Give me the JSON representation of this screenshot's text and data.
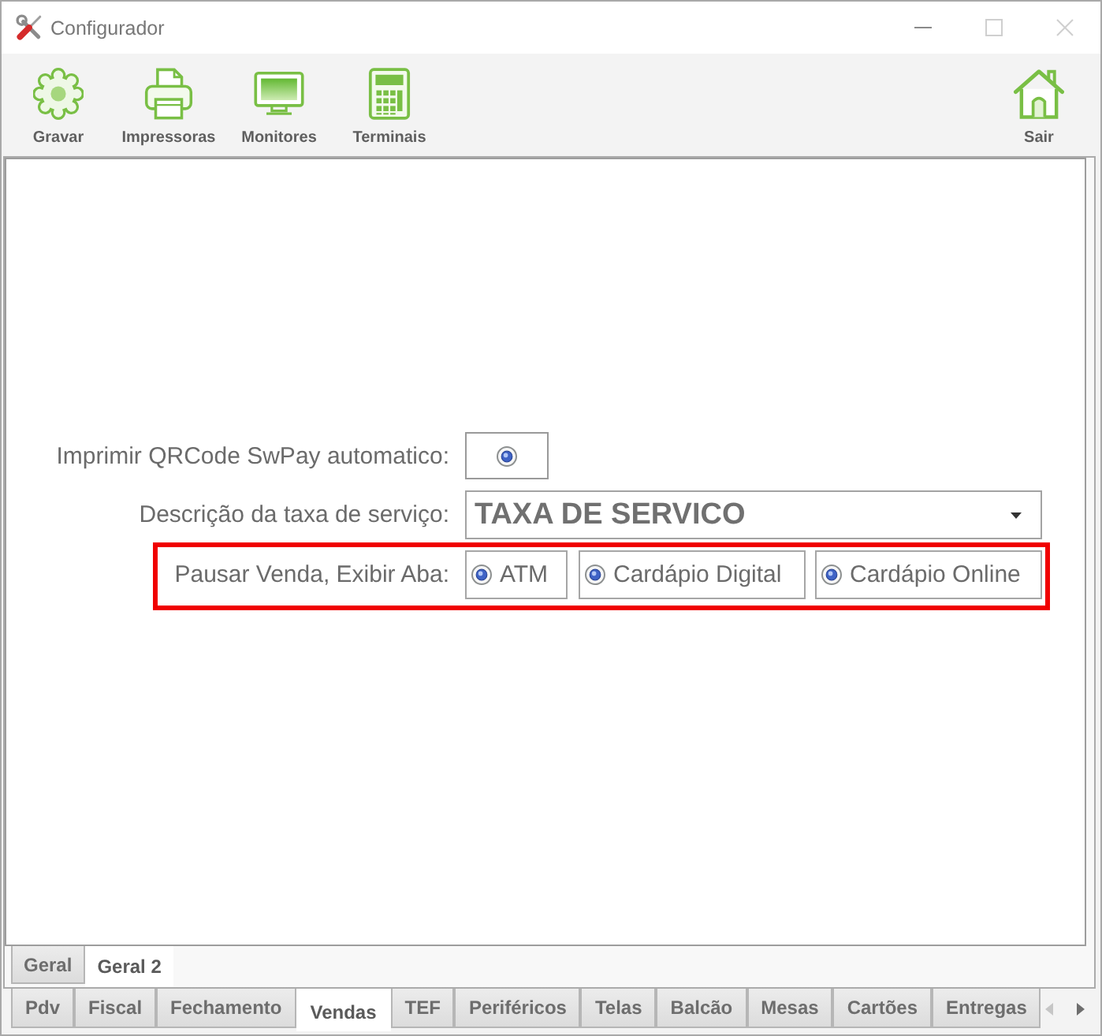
{
  "window": {
    "title": "Configurador"
  },
  "toolbar": {
    "left": [
      {
        "kind": "gear",
        "label": "Gravar"
      },
      {
        "kind": "printer",
        "label": "Impressoras"
      },
      {
        "kind": "monitor",
        "label": "Monitores"
      },
      {
        "kind": "calculator",
        "label": "Terminais"
      }
    ],
    "right": [
      {
        "kind": "home",
        "label": "Sair"
      }
    ]
  },
  "form": {
    "rows": [
      {
        "kind": "check",
        "label": "Imprimir QRCode SwPay automatico:",
        "checked": true
      },
      {
        "kind": "dropdown",
        "label": "Descrição da taxa de serviço:",
        "value": "TAXA DE SERVICO"
      },
      {
        "kind": "options",
        "label": "Pausar Venda, Exibir Aba:",
        "highlighted": true,
        "options": [
          {
            "label": "ATM",
            "checked": true
          },
          {
            "label": "Cardápio Digital",
            "checked": true
          },
          {
            "label": "Cardápio Online",
            "checked": true
          }
        ]
      }
    ]
  },
  "inner_tabs": [
    {
      "label": "Geral",
      "selected": false
    },
    {
      "label": "Geral 2",
      "selected": true
    }
  ],
  "outer_tabs": [
    {
      "label": "Pdv",
      "selected": false
    },
    {
      "label": "Fiscal",
      "selected": false
    },
    {
      "label": "Fechamento",
      "selected": false
    },
    {
      "label": "Vendas",
      "selected": true
    },
    {
      "label": "TEF",
      "selected": false
    },
    {
      "label": "Periféricos",
      "selected": false
    },
    {
      "label": "Telas",
      "selected": false
    },
    {
      "label": "Balcão",
      "selected": false
    },
    {
      "label": "Mesas",
      "selected": false
    },
    {
      "label": "Cartões",
      "selected": false
    },
    {
      "label": "Entregas",
      "selected": false
    }
  ]
}
